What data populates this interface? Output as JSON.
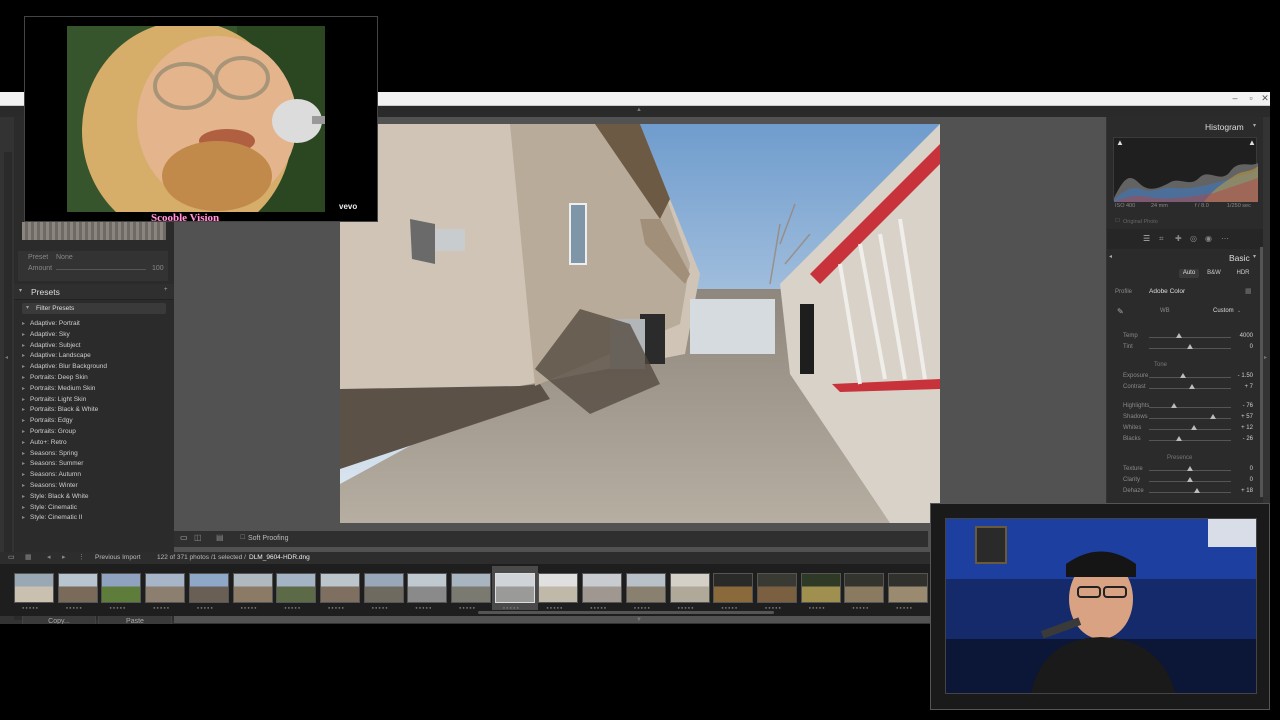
{
  "app": {
    "window_controls": [
      "–",
      "▫",
      "✕"
    ]
  },
  "left_panel": {
    "navigator_preset_label": "Preset",
    "navigator_preset_value": "None",
    "navigator_amount_label": "Amount",
    "navigator_amount_value": "100",
    "presets_header": "Presets",
    "filter_presets": "Filter Presets",
    "presets": [
      "Adaptive: Portrait",
      "Adaptive: Sky",
      "Adaptive: Subject",
      "Adaptive: Landscape",
      "Adaptive: Blur Background",
      "Portraits: Deep Skin",
      "Portraits: Medium Skin",
      "Portraits: Light Skin",
      "Portraits: Black & White",
      "Portraits: Edgy",
      "Portraits: Group",
      "Auto+: Retro",
      "Seasons: Spring",
      "Seasons: Summer",
      "Seasons: Autumn",
      "Seasons: Winter",
      "Style: Black & White",
      "Style: Cinematic",
      "Style: Cinematic II"
    ],
    "copy_button": "Copy...",
    "paste_button": "Paste"
  },
  "toolbar": {
    "soft_proofing": "Soft Proofing"
  },
  "filmstrip": {
    "source": "Previous Import",
    "count": "122 of 371 photos /1 selected /",
    "filename": "DLM_9604-HDR.dng",
    "thumbnail_count": 21,
    "selected_index": 11
  },
  "right_panel": {
    "histogram_title": "Histogram",
    "iso": "ISO 400",
    "focal": "24 mm",
    "aperture": "f / 8.0",
    "shutter": "1/250 sec",
    "original_photo": "Original Photo",
    "basic_title": "Basic",
    "auto_label": "Auto",
    "bw_label": "B&W",
    "hdr_label": "HDR",
    "profile_label": "Profile",
    "profile_value": "Adobe Color",
    "wb_label": "WB",
    "wb_value": "Custom",
    "temp_label": "Temp",
    "temp_value": "4000",
    "tint_label": "Tint",
    "tint_value": "0",
    "tone_label": "Tone",
    "exposure_label": "Exposure",
    "exposure_value": "- 1.50",
    "contrast_label": "Contrast",
    "contrast_value": "+ 7",
    "highlights_label": "Highlights",
    "highlights_value": "- 76",
    "shadows_label": "Shadows",
    "shadows_value": "+ 57",
    "whites_label": "Whites",
    "whites_value": "+ 12",
    "blacks_label": "Blacks",
    "blacks_value": "- 26",
    "presence_label": "Presence",
    "texture_label": "Texture",
    "texture_value": "0",
    "clarity_label": "Clarity",
    "clarity_value": "0",
    "dehaze_label": "Dehaze",
    "dehaze_value": "+ 18",
    "slider_levels": {
      "temp": 0.37,
      "tint": 0.5,
      "exposure": 0.42,
      "contrast": 0.52,
      "highlights": 0.31,
      "shadows": 0.78,
      "whites": 0.55,
      "blacks": 0.37,
      "texture": 0.5,
      "clarity": 0.5,
      "dehaze": 0.59
    }
  },
  "music_video": {
    "watermark": "vevo",
    "caption": "Scooble Vision"
  },
  "colors": {
    "panel_bg": "#2b2b2b",
    "center_bg": "#525252",
    "caption_color": "#ff9ae8",
    "accent_red": "#c8323a"
  }
}
